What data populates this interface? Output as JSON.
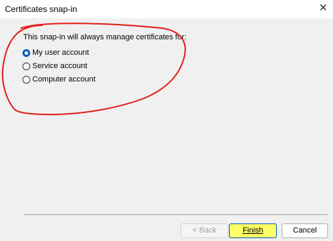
{
  "window": {
    "title": "Certificates snap-in"
  },
  "prompt": "This snap-in will always manage certificates for:",
  "options": [
    {
      "label": "My user account",
      "checked": true
    },
    {
      "label": "Service account",
      "checked": false
    },
    {
      "label": "Computer account",
      "checked": false
    }
  ],
  "buttons": {
    "back": "< Back",
    "finish": "Finish",
    "cancel": "Cancel"
  },
  "colors": {
    "accent": "#005fb8",
    "annotation": "#e0201a",
    "highlight": "#ffff66"
  },
  "icons": {
    "close": "close-icon"
  }
}
